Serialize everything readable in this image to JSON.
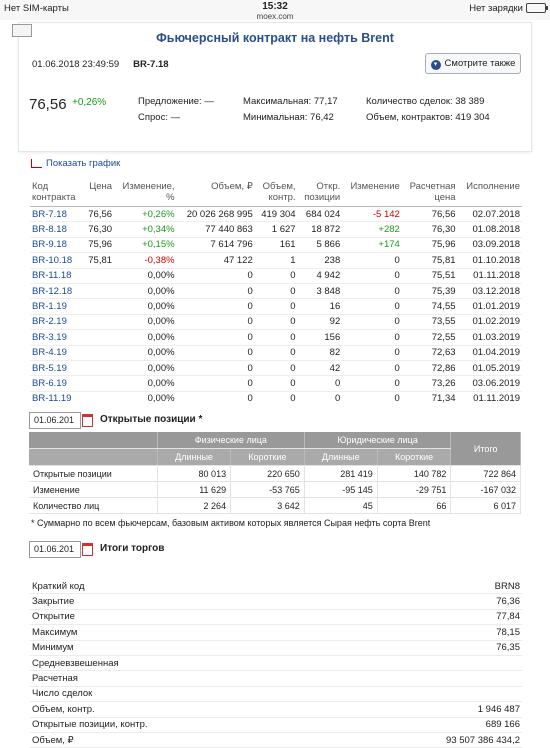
{
  "status_bar": {
    "carrier": "Нет SIM-карты",
    "time": "15:32",
    "host": "moex.com",
    "charging": "Нет зарядки"
  },
  "header": {
    "title": "Фьючерсный контракт на нефть Brent",
    "datetime": "01.06.2018 23:49:59",
    "code": "BR-7.18",
    "see_also_label": "Смотрите также"
  },
  "quote": {
    "price": "76,56",
    "change": "+0,26%",
    "offer_label": "Предложение:",
    "offer": "—",
    "bid_label": "Спрос:",
    "bid": "—",
    "max_label": "Максимальная:",
    "max": "77,17",
    "min_label": "Минимальная:",
    "min": "76,42",
    "deals_label": "Количество сделок:",
    "deals": "38 389",
    "volume_label": "Объем, контрактов:",
    "volume": "419 304"
  },
  "chart_link": "Показать график",
  "futures": {
    "headers": [
      "Код\nконтракта",
      "Цена",
      "Изменение,\n%",
      "Объем, ₽",
      "Объем,\nконтр.",
      "Откр.\nпозиции",
      "Изменение",
      "Расчетная\nцена",
      "Исполнение"
    ],
    "rows": [
      [
        "BR-7.18",
        "76,56",
        "+0,26%",
        "20 026 268 995",
        "419 304",
        "684 024",
        "-5 142",
        "76,56",
        "02.07.2018"
      ],
      [
        "BR-8.18",
        "76,30",
        "+0,34%",
        "77 440 863",
        "1 627",
        "18 872",
        "+282",
        "76,30",
        "01.08.2018"
      ],
      [
        "BR-9.18",
        "75,96",
        "+0,15%",
        "7 614 796",
        "161",
        "5 866",
        "+174",
        "75,96",
        "03.09.2018"
      ],
      [
        "BR-10.18",
        "75,81",
        "-0,38%",
        "47 122",
        "1",
        "238",
        "0",
        "75,81",
        "01.10.2018"
      ],
      [
        "BR-11.18",
        "",
        "0,00%",
        "0",
        "0",
        "4 942",
        "0",
        "75,51",
        "01.11.2018"
      ],
      [
        "BR-12.18",
        "",
        "0,00%",
        "0",
        "0",
        "3 848",
        "0",
        "75,39",
        "03.12.2018"
      ],
      [
        "BR-1.19",
        "",
        "0,00%",
        "0",
        "0",
        "16",
        "0",
        "74,55",
        "01.01.2019"
      ],
      [
        "BR-2.19",
        "",
        "0,00%",
        "0",
        "0",
        "92",
        "0",
        "73,55",
        "01.02.2019"
      ],
      [
        "BR-3.19",
        "",
        "0,00%",
        "0",
        "0",
        "156",
        "0",
        "72,55",
        "01.03.2019"
      ],
      [
        "BR-4.19",
        "",
        "0,00%",
        "0",
        "0",
        "82",
        "0",
        "72,63",
        "01.04.2019"
      ],
      [
        "BR-5.19",
        "",
        "0,00%",
        "0",
        "0",
        "42",
        "0",
        "72,86",
        "01.05.2019"
      ],
      [
        "BR-6.19",
        "",
        "0,00%",
        "0",
        "0",
        "0",
        "0",
        "73,26",
        "03.06.2019"
      ],
      [
        "BR-11.19",
        "",
        "0,00%",
        "0",
        "0",
        "0",
        "0",
        "71,34",
        "01.11.2019"
      ]
    ]
  },
  "open_positions": {
    "date": "01.06.201",
    "title": "Открытые позиции *",
    "group_phys": "Физические лица",
    "group_jur": "Юридические лица",
    "total": "Итого",
    "long": "Длинные",
    "short": "Короткие",
    "rows": [
      [
        "Открытые позиции",
        "80 013",
        "220 650",
        "281 419",
        "140 782",
        "722 864"
      ],
      [
        "Изменение",
        "11 629",
        "-53 765",
        "-95 145",
        "-29 751",
        "-167 032"
      ],
      [
        "Количество лиц",
        "2 264",
        "3 642",
        "45",
        "66",
        "6 017"
      ]
    ],
    "note": "* Суммарно по всем фьючерсам, базовым активом которых является Сырая нефть сорта Brent"
  },
  "trade_results": {
    "date": "01.06.201",
    "title": "Итоги торгов",
    "rows": [
      [
        "Краткий код",
        "BRN8"
      ],
      [
        "Закрытие",
        "76,36"
      ],
      [
        "Открытие",
        "77,84"
      ],
      [
        "Максимум",
        "78,15"
      ],
      [
        "Минимум",
        "76,35"
      ],
      [
        "Средневзвешенная",
        ""
      ],
      [
        "Расчетная",
        ""
      ],
      [
        "Число сделок",
        ""
      ],
      [
        "Объем, контр.",
        "1 946 487"
      ],
      [
        "Открытые позиции, контр.",
        "689 166"
      ],
      [
        "Объем, ₽",
        "93 507 386 434,2"
      ]
    ]
  }
}
